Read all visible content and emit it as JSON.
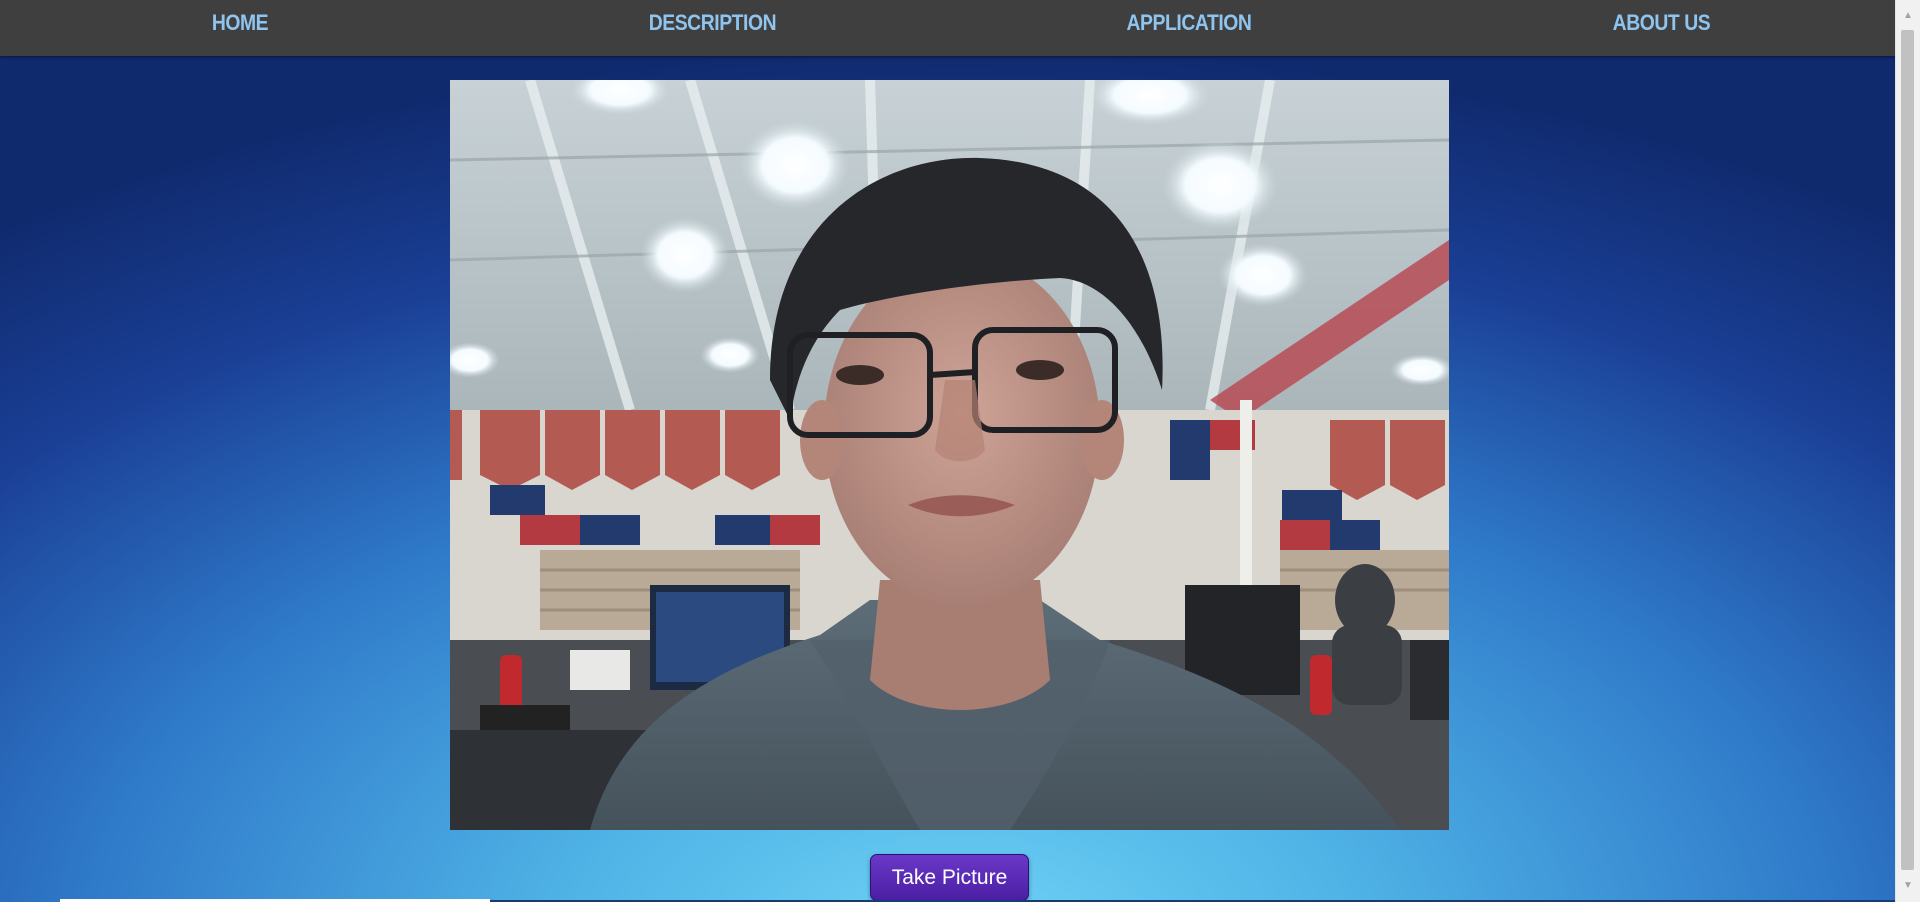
{
  "nav": {
    "items": [
      {
        "label": "HOME"
      },
      {
        "label": "DESCRIPTION"
      },
      {
        "label": "APPLICATION"
      },
      {
        "label": "ABOUT US"
      }
    ]
  },
  "camera": {
    "icon": "webcam-feed"
  },
  "actions": {
    "take_picture_label": "Take Picture"
  },
  "colors": {
    "nav_bg": "#3f3f3f",
    "nav_text": "#8fc4ee",
    "button_bg": "#5a2bb6",
    "bg_top": "#102a6e",
    "bg_bottom": "#6fd3f7"
  }
}
